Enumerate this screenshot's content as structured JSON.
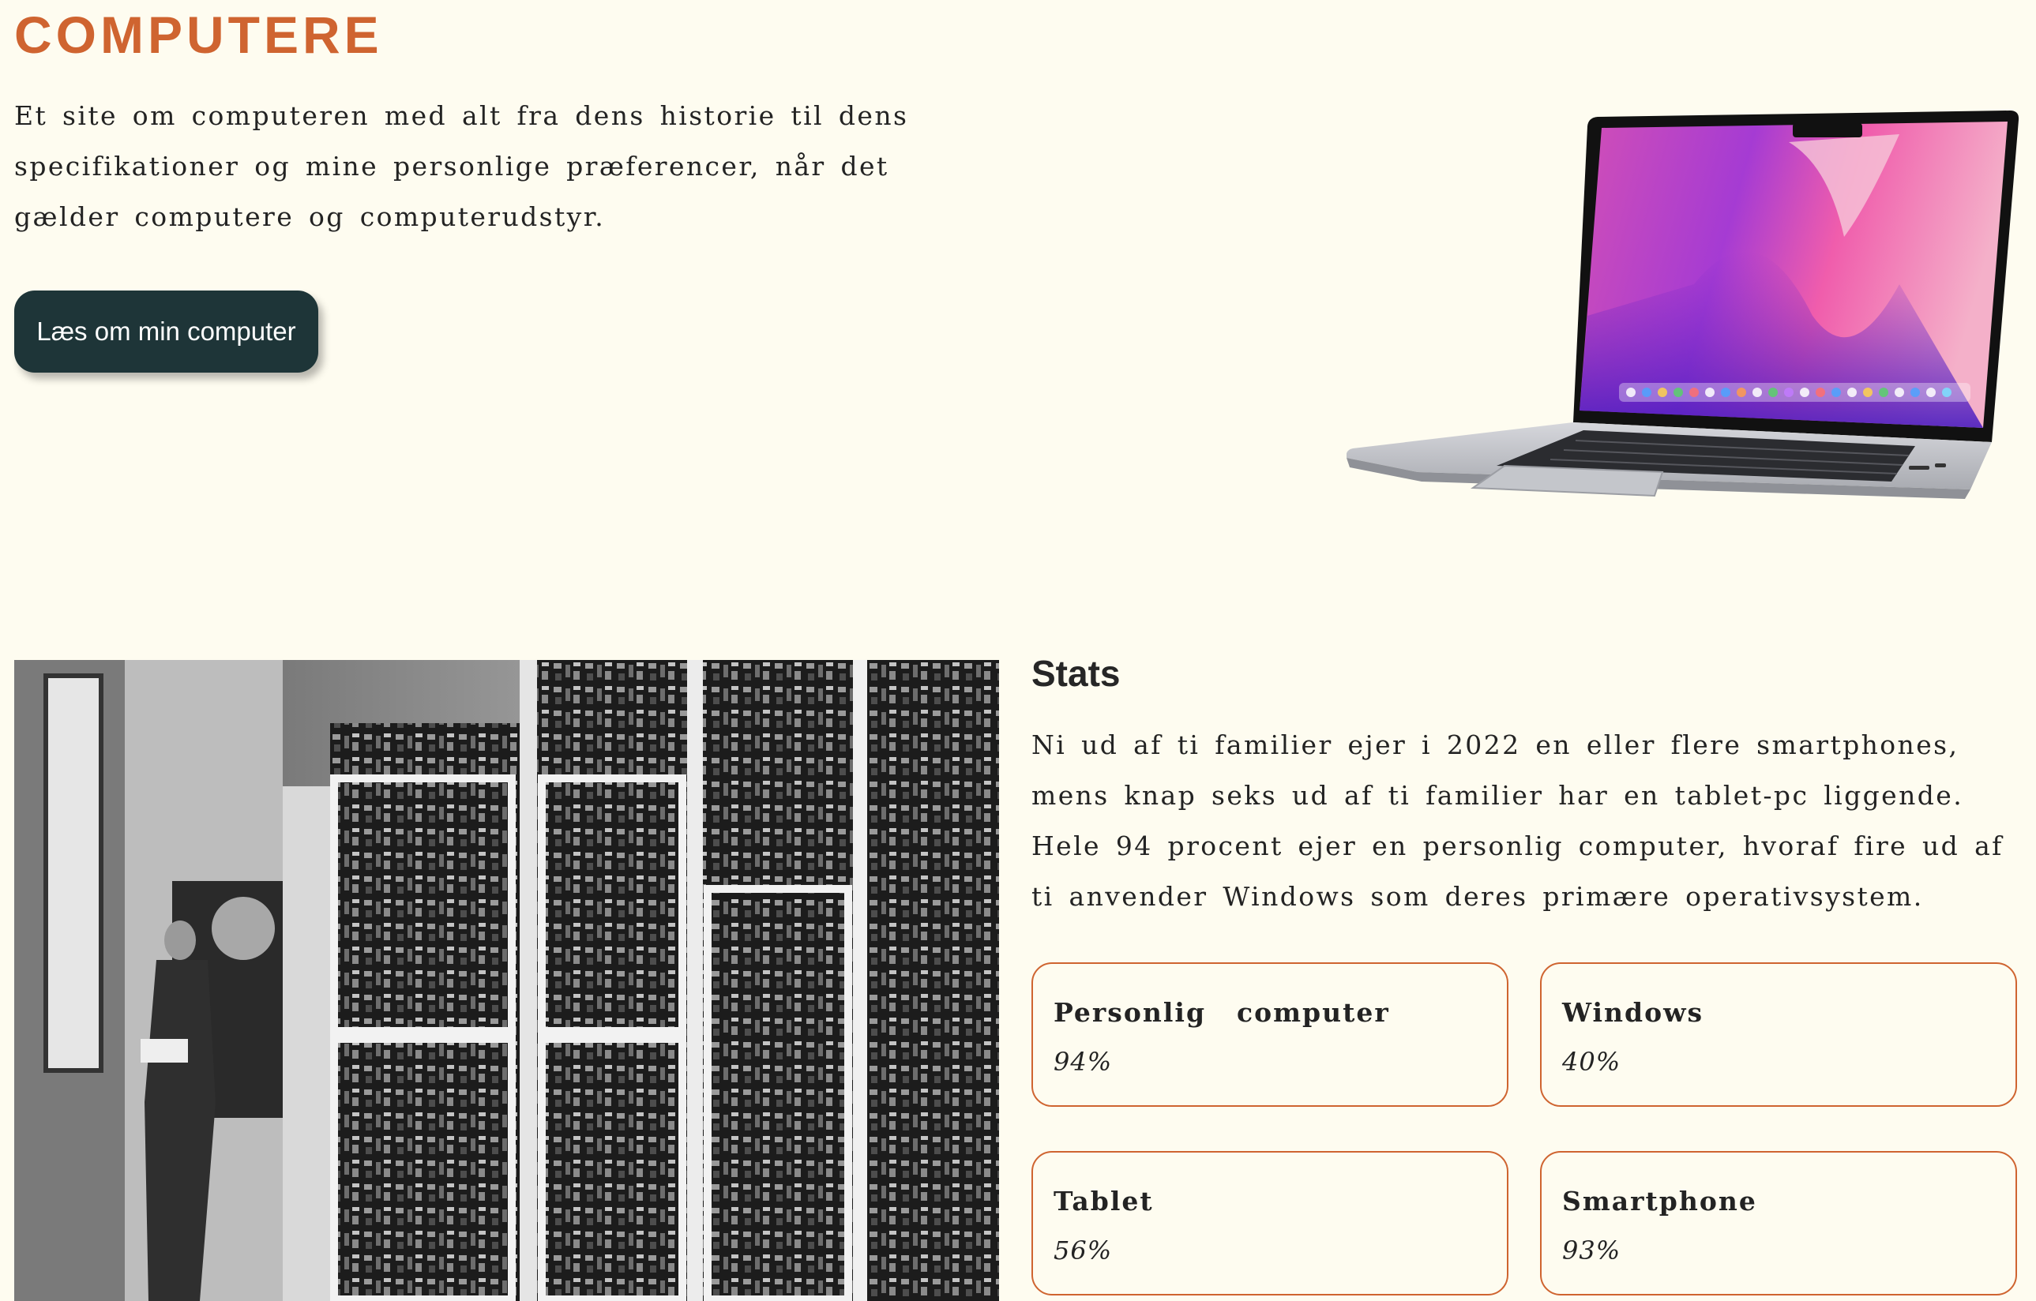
{
  "hero": {
    "title": "COMPUTERE",
    "description": "Et site om computeren med alt fra dens historie til dens specifikationer og mine personlige præferencer, når det gælder computere og computerudstyr.",
    "button_label": "Læs om min computer"
  },
  "images": {
    "laptop": "laptop-image",
    "mainframe": "mainframe-photo"
  },
  "stats": {
    "title": "Stats",
    "description": "Ni ud af ti familier ejer i 2022 en eller flere smartphones, mens knap seks ud af ti familier har en tablet-pc liggende. Hele 94 procent ejer en personlig computer, hvoraf fire ud af ti anvender Windows som deres primære operativsystem.",
    "cards": [
      {
        "label": "Personlig  computer",
        "value": "94%"
      },
      {
        "label": "Windows",
        "value": "40%"
      },
      {
        "label": "Tablet",
        "value": "56%"
      },
      {
        "label": "Smartphone",
        "value": "93%"
      }
    ]
  },
  "colors": {
    "background": "#fefcf0",
    "accent": "#cf6430",
    "button": "#1e3538"
  }
}
